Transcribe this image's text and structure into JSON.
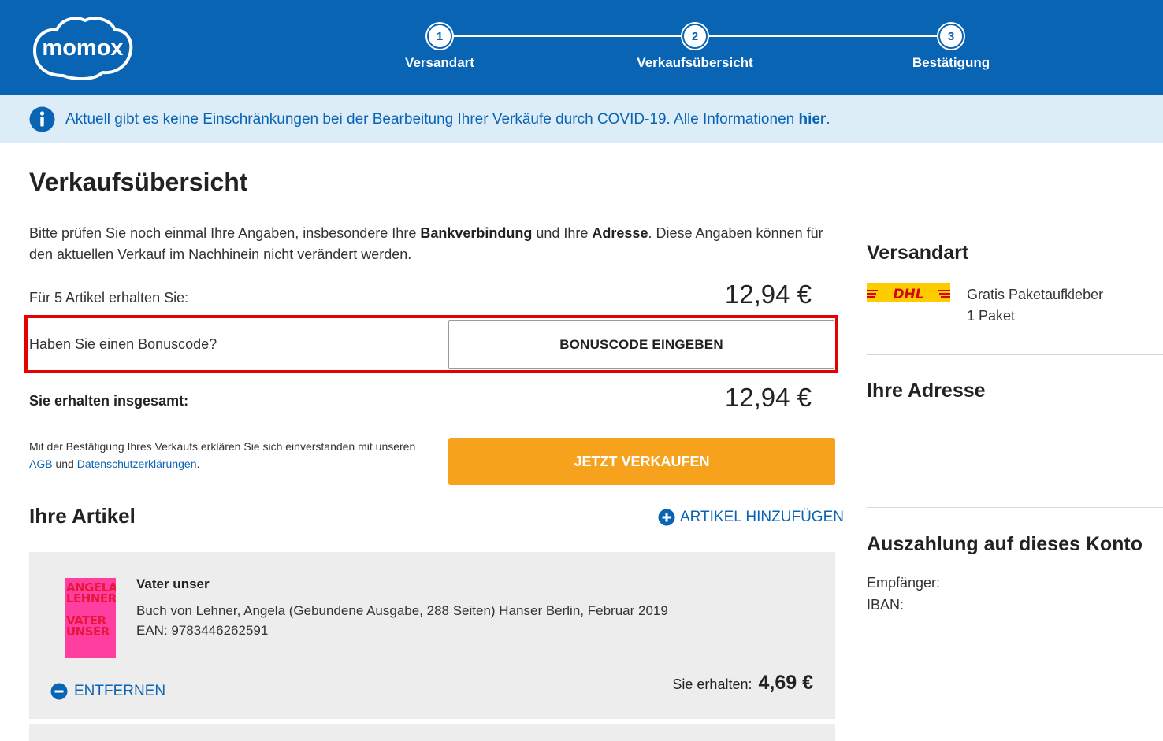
{
  "header": {
    "logo_text": "momox",
    "steps": [
      {
        "number": "1",
        "label": "Versandart"
      },
      {
        "number": "2",
        "label": "Verkaufsübersicht"
      },
      {
        "number": "3",
        "label": "Bestätigung"
      }
    ]
  },
  "banner": {
    "text": "Aktuell gibt es keine Einschränkungen bei der Bearbeitung Ihrer Verkäufe durch COVID-19. Alle Informationen ",
    "link": "hier",
    "suffix": "."
  },
  "main": {
    "title": "Verkaufsübersicht",
    "intro_1": "Bitte prüfen Sie noch einmal Ihre Angaben, insbesondere Ihre ",
    "intro_bank": "Bankverbindung",
    "intro_2": " und Ihre ",
    "intro_address": "Adresse",
    "intro_3": ". Diese Angaben können für den aktuellen Verkauf im Nachhinein nicht verändert werden.",
    "articles_label": "Für 5 Artikel erhalten Sie:",
    "articles_amount": "12,94 €",
    "bonus_label": "Haben Sie einen Bonuscode?",
    "bonus_button": "BONUSCODE EINGEBEN",
    "total_label": "Sie erhalten insgesamt:",
    "total_amount": "12,94 €",
    "terms_1": "Mit der Bestätigung Ihres Verkaufs erklären Sie sich einverstanden mit unseren ",
    "terms_agb": "AGB",
    "terms_2": " und ",
    "terms_privacy": "Datenschutzerklärungen",
    "terms_3": ".",
    "sell_button": "JETZT VERKAUFEN",
    "articles_title": "Ihre Artikel",
    "add_article": "ARTIKEL HINZUFÜGEN"
  },
  "article": {
    "cover_lines": [
      "ANGELA",
      "LEHNER",
      "VATER",
      "UNSER"
    ],
    "title": "Vater unser",
    "desc": "Buch von Lehner, Angela (Gebundene Ausgabe, 288 Seiten) Hanser Berlin, Februar 2019",
    "ean": "EAN: 9783446262591",
    "remove": "ENTFERNEN",
    "receive_label": "Sie erhalten:",
    "receive_amount": "4,69 €"
  },
  "sidebar": {
    "shipping_title": "Versandart",
    "shipping_carrier": "DHL",
    "shipping_line1": "Gratis Paketaufkleber",
    "shipping_line2": "1 Paket",
    "address_title": "Ihre Adresse",
    "payout_title": "Auszahlung auf dieses Konto",
    "recipient_label": "Empfänger:",
    "iban_label": "IBAN:"
  },
  "colors": {
    "brand_blue": "#0a64b4",
    "banner_bg": "#dcedf8",
    "sell_orange": "#f7a21d",
    "highlight_red": "#e60000",
    "dhl_yellow": "#ffcc00",
    "dhl_red": "#d40511"
  }
}
